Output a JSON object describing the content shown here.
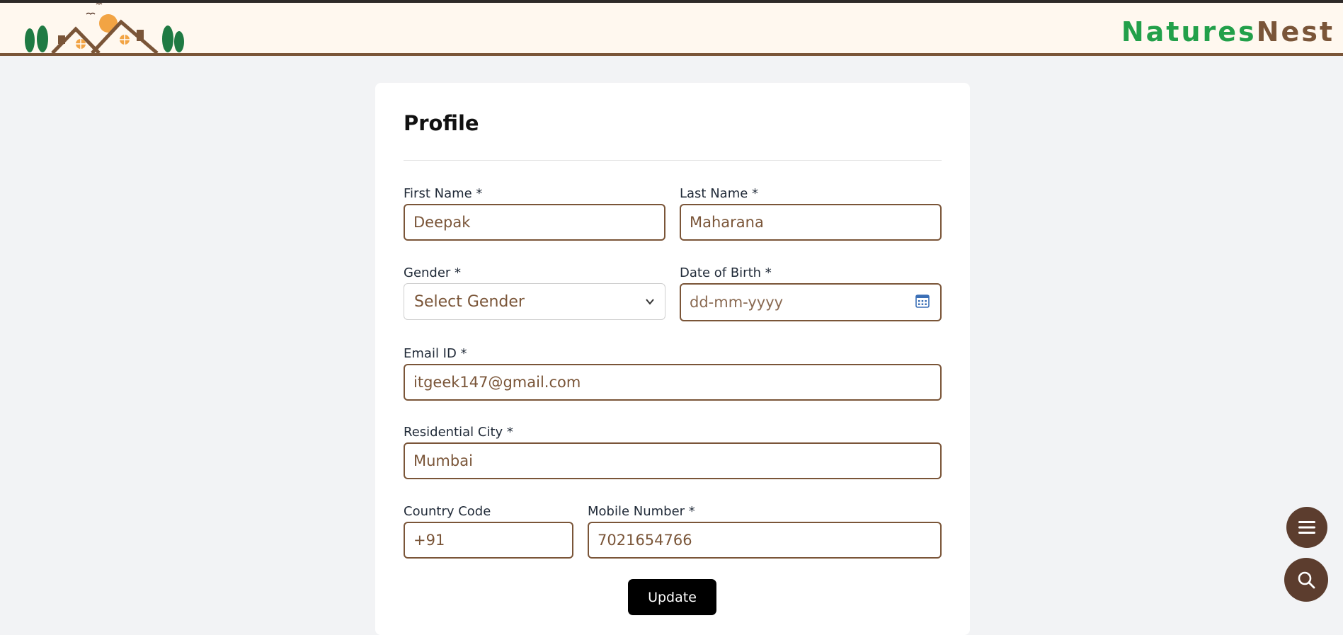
{
  "header": {
    "brand_part1": "Natures",
    "brand_part2": "Nest",
    "colors": {
      "green": "#22a04a",
      "brown": "#7a5538",
      "background": "#fff8ef"
    }
  },
  "form": {
    "title": "Profile",
    "first_name": {
      "label": "First Name *",
      "value": "Deepak"
    },
    "last_name": {
      "label": "Last Name *",
      "value": "Maharana"
    },
    "gender": {
      "label": "Gender *",
      "selected": "Select Gender"
    },
    "dob": {
      "label": "Date of Birth *",
      "placeholder": "dd-mm-yyyy"
    },
    "email": {
      "label": "Email ID *",
      "value": "itgeek147@gmail.com"
    },
    "city": {
      "label": "Residential City *",
      "value": "Mumbai"
    },
    "country_code": {
      "label": "Country Code",
      "value": "+91"
    },
    "mobile": {
      "label": "Mobile Number *",
      "value": "7021654766"
    },
    "update_label": "Update"
  },
  "floating": {
    "menu_icon": "hamburger-icon",
    "search_icon": "search-icon",
    "color": "#5c3d2e"
  }
}
